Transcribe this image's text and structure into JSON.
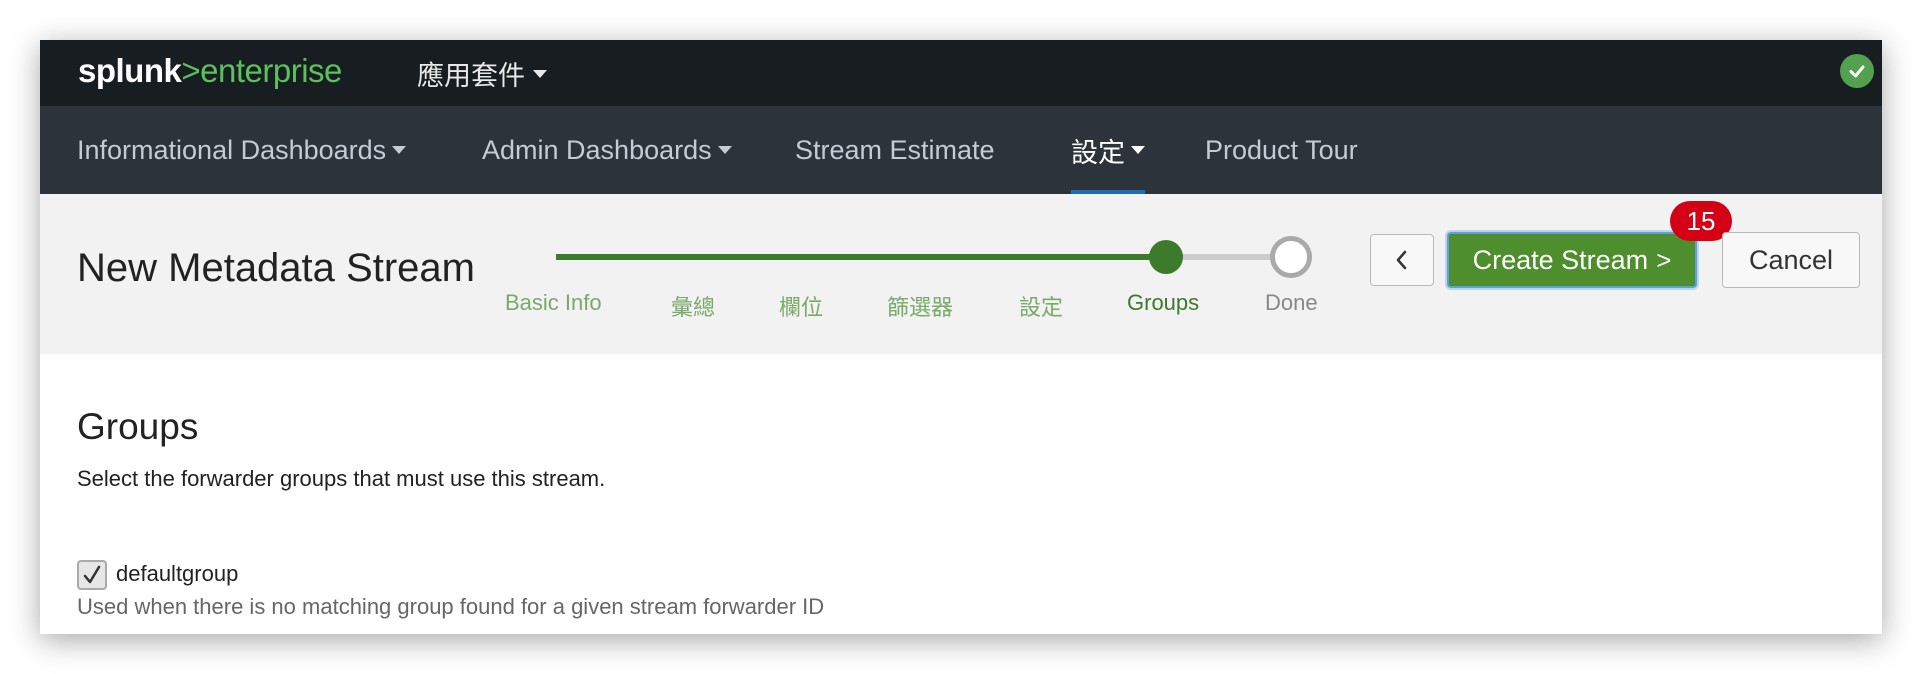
{
  "topbar": {
    "logo_part1": "splunk",
    "logo_part2": ">",
    "logo_part3": "enterprise",
    "apps_menu": "應用套件"
  },
  "nav": {
    "items": [
      {
        "label": "Informational Dashboards"
      },
      {
        "label": "Admin Dashboards"
      },
      {
        "label": "Stream Estimate"
      },
      {
        "label": "設定"
      },
      {
        "label": "Product Tour"
      }
    ]
  },
  "wizard": {
    "title": "New Metadata Stream",
    "steps": [
      "Basic Info",
      "彙總",
      "欄位",
      "篩選器",
      "設定",
      "Groups",
      "Done"
    ],
    "current_step": "Groups",
    "back_label": "<",
    "create_label": "Create Stream",
    "create_chevron": ">",
    "cancel_label": "Cancel",
    "badge": "15"
  },
  "content": {
    "title": "Groups",
    "description": "Select the forwarder groups that must use this stream.",
    "group": {
      "label": "defaultgroup",
      "checked": true,
      "help": "Used when there is no matching group found for a given stream forwarder ID"
    }
  },
  "colors": {
    "topbar": "#171d21",
    "navbar": "#2c333b",
    "brand_green": "#5cc05c",
    "step_done": "#3c7a2c",
    "primary_button": "#4e8e2c",
    "badge": "#d40016",
    "status_ok": "#53a051"
  }
}
